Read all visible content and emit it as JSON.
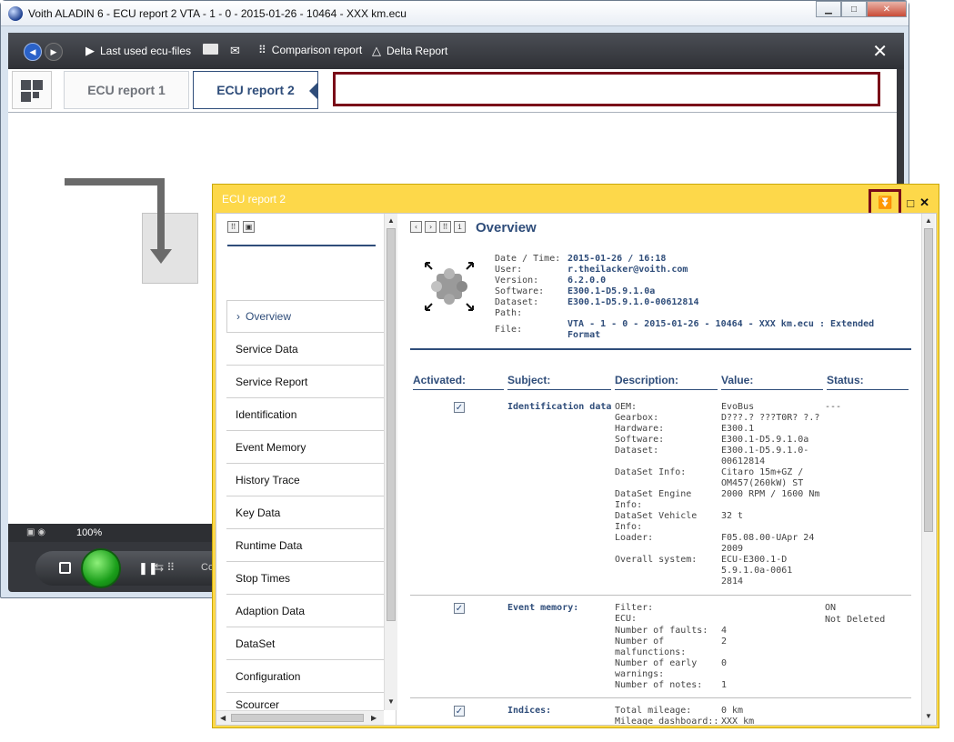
{
  "window": {
    "title": "Voith ALADIN 6 - ECU report 2 VTA - 1 - 0 - 2015-01-26 - 10464 - XXX km.ecu"
  },
  "toolbar": {
    "last_used": "Last used ecu-files",
    "comparison": "Comparison report",
    "delta": "Delta Report"
  },
  "tabs": [
    "ECU report 1",
    "ECU report 2"
  ],
  "status": {
    "zoom": "100%"
  },
  "bottom": {
    "text": "Co"
  },
  "dialog": {
    "title": "ECU report 2"
  },
  "nav": {
    "items": [
      "Overview",
      "Service Data",
      "Service Report",
      "Identification",
      "Event Memory",
      "History Trace",
      "Key Data",
      "Runtime Data",
      "Stop Times",
      "Adaption Data",
      "DataSet",
      "Configuration",
      "Scourcer"
    ]
  },
  "report": {
    "title": "Overview",
    "meta": {
      "labels": [
        "Date / Time:",
        "User:",
        "Version:",
        "Software:",
        "Dataset:",
        "Path:"
      ],
      "values": [
        "2015-01-26 / 16:18",
        "r.theilacker@voith.com",
        "6.2.0.0",
        "E300.1-D5.9.1.0a",
        "E300.1-D5.9.1.0-00612814",
        ""
      ],
      "file_label": "File:",
      "file_value": "VTA - 1 - 0 - 2015-01-26 - 10464 - XXX km.ecu : Extended Format"
    },
    "columns": [
      "Activated:",
      "Subject:",
      "Description:",
      "Value:",
      "Status:"
    ],
    "sections": [
      {
        "subject": "Identification data",
        "status": "---",
        "rows": [
          {
            "d": "OEM:",
            "v": "EvoBus"
          },
          {
            "d": "Gearbox:",
            "v": "D???.? ???T0R? ?.?"
          },
          {
            "d": "Hardware:",
            "v": "E300.1"
          },
          {
            "d": "Software:",
            "v": "E300.1-D5.9.1.0a"
          },
          {
            "d": "Dataset:",
            "v": "E300.1-D5.9.1.0-00612814"
          },
          {
            "d": "DataSet Info:",
            "v": "Citaro 15m+GZ / OM457(260kW) ST"
          },
          {
            "d": "DataSet Engine Info:",
            "v": "2000 RPM / 1600 Nm"
          },
          {
            "d": "DataSet Vehicle Info:",
            "v": "32 t"
          },
          {
            "d": "Loader:",
            "v": "F05.08.00-UApr 24 2009"
          },
          {
            "d": "Overall system:",
            "v": "ECU-E300.1-D5.9.1.0a-00612814"
          }
        ]
      },
      {
        "subject": "Event memory:",
        "status_lines": [
          "ON",
          "Not Deleted"
        ],
        "rows": [
          {
            "d": "Filter:",
            "v": ""
          },
          {
            "d": "ECU:",
            "v": ""
          },
          {
            "d": "Number of faults:",
            "v": "4"
          },
          {
            "d": "Number of malfunctions:",
            "v": "2"
          },
          {
            "d": "Number of early warnings:",
            "v": "0"
          },
          {
            "d": "Number of notes:",
            "v": "1"
          }
        ]
      },
      {
        "subject": "Indices:",
        "rows": [
          {
            "d": "Total mileage:",
            "v": "0 km"
          },
          {
            "d": "Mileage dashboard::",
            "v": "XXX km"
          }
        ]
      }
    ]
  }
}
